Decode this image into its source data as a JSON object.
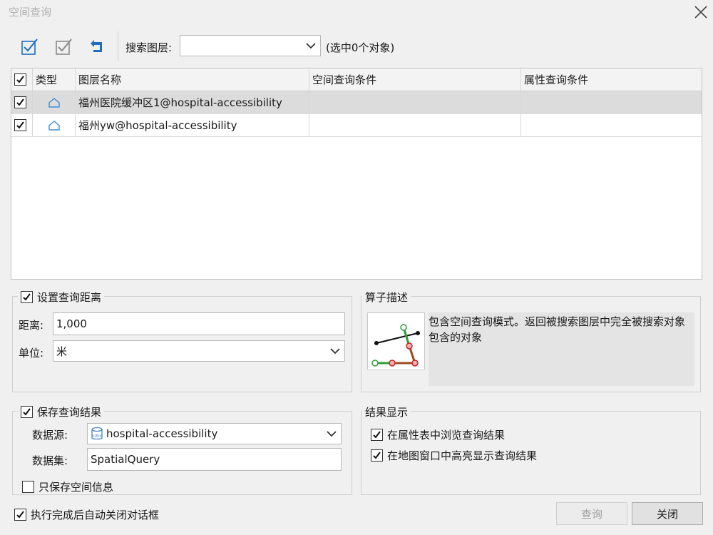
{
  "window": {
    "title": "空间查询"
  },
  "toolbar": {
    "search_layer_label": "搜索图层:",
    "search_layer_value": "",
    "selection_info": "(选中0个对象)"
  },
  "table": {
    "headers": [
      "类型",
      "图层名称",
      "空间查询条件",
      "属性查询条件"
    ],
    "rows": [
      {
        "checked": true,
        "layer_name": "福州医院缓冲区1@hospital-accessibility",
        "spatial_condition": "",
        "attribute_condition": ""
      },
      {
        "checked": true,
        "layer_name": "福州yw@hospital-accessibility",
        "spatial_condition": "",
        "attribute_condition": ""
      }
    ]
  },
  "distance": {
    "group_label": "设置查询距离",
    "distance_label": "距离:",
    "distance_value": "1,000",
    "unit_label": "单位:",
    "unit_value": "米"
  },
  "operator": {
    "group_label": "算子描述",
    "description": "包含空间查询模式。返回被搜索图层中完全被搜索对象包含的对象"
  },
  "save": {
    "group_label": "保存查询结果",
    "datasource_label": "数据源:",
    "datasource_value": "hospital-accessibility",
    "datasource_icon": "udbx",
    "dataset_label": "数据集:",
    "dataset_value": "SpatialQuery",
    "only_spatial_label": "只保存空间信息"
  },
  "display": {
    "group_label": "结果显示",
    "browse_attr_label": "在属性表中浏览查询结果",
    "highlight_map_label": "在地图窗口中高亮显示查询结果"
  },
  "footer": {
    "auto_close_label": "执行完成后自动关闭对话框",
    "query_button": "查询",
    "close_button": "关闭"
  },
  "colors": {
    "accent": "#1e6fbf",
    "disabled_text": "#a0a0a0"
  }
}
